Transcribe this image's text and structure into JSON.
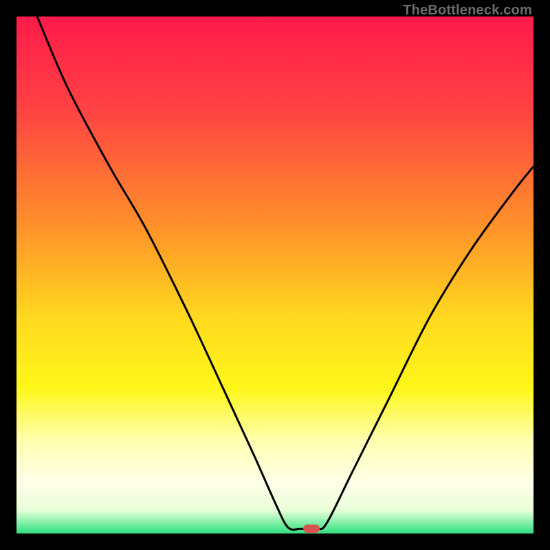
{
  "watermark": "TheBottleneck.com",
  "chart_data": {
    "type": "line",
    "title": "",
    "xlabel": "",
    "ylabel": "",
    "xlim": [
      0,
      100
    ],
    "ylim": [
      0,
      100
    ],
    "gradient_stops": [
      {
        "pos": 0.0,
        "color": "#ff1a4a"
      },
      {
        "pos": 0.18,
        "color": "#ff4243"
      },
      {
        "pos": 0.4,
        "color": "#ff8f2a"
      },
      {
        "pos": 0.58,
        "color": "#ffd81f"
      },
      {
        "pos": 0.72,
        "color": "#fff71a"
      },
      {
        "pos": 0.82,
        "color": "#ffffb0"
      },
      {
        "pos": 0.9,
        "color": "#ffffe8"
      },
      {
        "pos": 0.955,
        "color": "#e8ffd8"
      },
      {
        "pos": 0.99,
        "color": "#55e892"
      },
      {
        "pos": 1.0,
        "color": "#36dd83"
      }
    ],
    "series": [
      {
        "name": "bottleneck-curve",
        "points": [
          {
            "x": 4,
            "y": 100
          },
          {
            "x": 10,
            "y": 86
          },
          {
            "x": 18,
            "y": 71
          },
          {
            "x": 25,
            "y": 59
          },
          {
            "x": 33,
            "y": 43
          },
          {
            "x": 40,
            "y": 28
          },
          {
            "x": 46,
            "y": 15
          },
          {
            "x": 50,
            "y": 6
          },
          {
            "x": 52.5,
            "y": 1.2
          },
          {
            "x": 55,
            "y": 0.9
          },
          {
            "x": 58,
            "y": 0.9
          },
          {
            "x": 60,
            "y": 2
          },
          {
            "x": 65,
            "y": 12
          },
          {
            "x": 72,
            "y": 26
          },
          {
            "x": 80,
            "y": 42
          },
          {
            "x": 88,
            "y": 55
          },
          {
            "x": 96,
            "y": 66
          },
          {
            "x": 100,
            "y": 71
          }
        ]
      }
    ],
    "marker": {
      "x": 57,
      "y": 0.9,
      "color": "#d9544f"
    }
  }
}
